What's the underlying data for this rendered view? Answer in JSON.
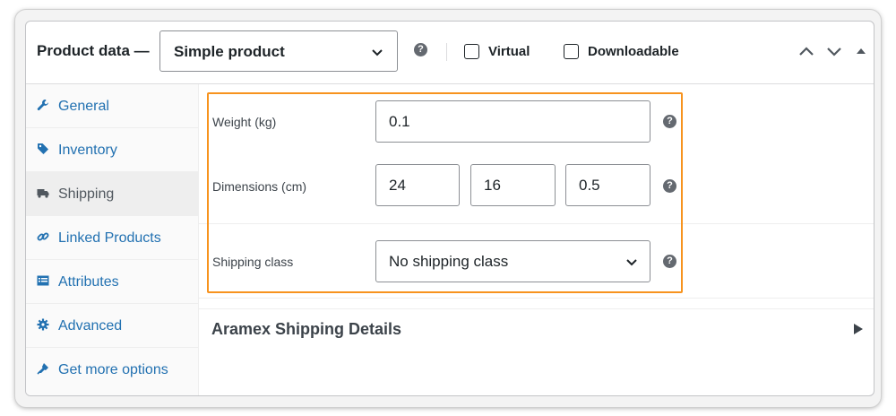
{
  "header": {
    "title": "Product data —",
    "product_type": "Simple product",
    "virtual_label": "Virtual",
    "downloadable_label": "Downloadable",
    "help_glyph": "?"
  },
  "sidebar": {
    "items": [
      {
        "label": "General",
        "icon": "wrench-icon",
        "active": false
      },
      {
        "label": "Inventory",
        "icon": "tag-icon",
        "active": false
      },
      {
        "label": "Shipping",
        "icon": "truck-icon",
        "active": true
      },
      {
        "label": "Linked Products",
        "icon": "link-icon",
        "active": false
      },
      {
        "label": "Attributes",
        "icon": "list-icon",
        "active": false
      },
      {
        "label": "Advanced",
        "icon": "gear-icon",
        "active": false
      },
      {
        "label": "Get more options",
        "icon": "plugin-icon",
        "active": false
      }
    ]
  },
  "shipping": {
    "weight_label": "Weight (kg)",
    "weight_value": "0.1",
    "dimensions_label": "Dimensions (cm)",
    "length": "24",
    "width": "16",
    "height": "0.5",
    "class_label": "Shipping class",
    "class_value": "No shipping class"
  },
  "aramex": {
    "title": "Aramex Shipping Details"
  },
  "colors": {
    "link": "#2271b1",
    "highlight": "#f7931e",
    "text": "#1d2327"
  }
}
